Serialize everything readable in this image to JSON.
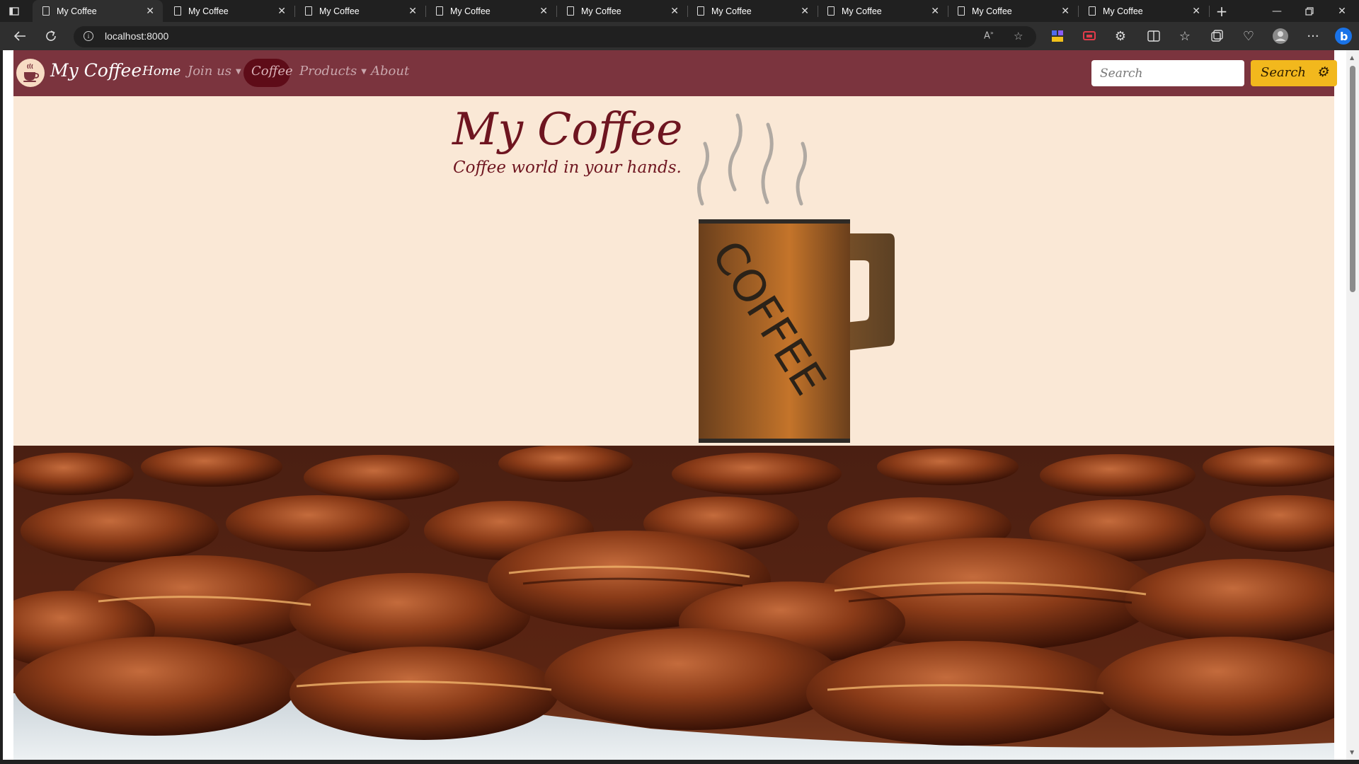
{
  "browser": {
    "tabs": [
      {
        "title": "My Coffee",
        "active": true
      },
      {
        "title": "My Coffee"
      },
      {
        "title": "My Coffee"
      },
      {
        "title": "My Coffee"
      },
      {
        "title": "My Coffee"
      },
      {
        "title": "My Coffee"
      },
      {
        "title": "My Coffee"
      },
      {
        "title": "My Coffee"
      },
      {
        "title": "My Coffee"
      }
    ],
    "address": "localhost:8000",
    "new_tab_symbol": "+",
    "icons": [
      "back-icon",
      "reload-icon",
      "info-icon",
      "read-aloud-icon",
      "favorite-icon",
      "extensions-icon",
      "split-screen-icon",
      "favorites-icon",
      "collections-icon",
      "performance-icon",
      "profile-icon",
      "more-icon",
      "copilot-icon"
    ]
  },
  "navbar": {
    "brand": "My Coffee",
    "links": {
      "home": "Home",
      "join": "Join us",
      "coffee": "Coffee",
      "products": "Products",
      "about": "About"
    },
    "search": {
      "placeholder": "Search",
      "button": "Search"
    },
    "colors": {
      "background": "#7b343e",
      "active_pill": "#5e0c18",
      "button": "#f2b81d"
    }
  },
  "hero": {
    "title": "My Coffee",
    "subtitle": "Coffee world in your hands.",
    "mug_text": "COFFEE",
    "background": "#fae8d6",
    "title_color": "#6e1520"
  },
  "banner": {
    "image": "coffee-beans-photo"
  }
}
